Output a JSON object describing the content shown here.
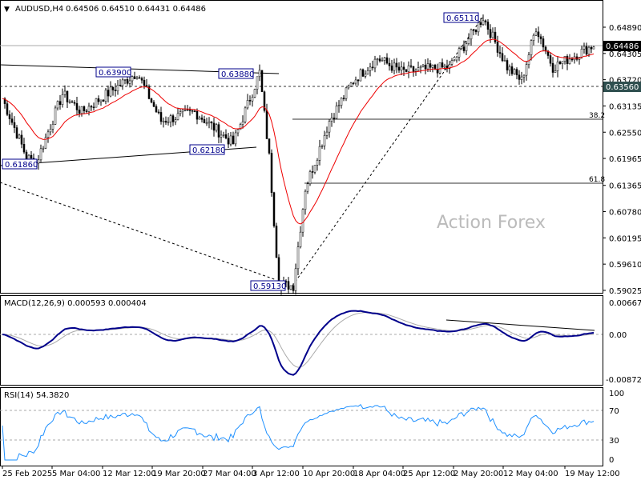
{
  "header": {
    "symbol_label": "AUDUSD,H4",
    "ohlc": "0.64506 0.64510 0.64431 0.64486"
  },
  "watermark": "Action Forex",
  "chart_data": {
    "type": "candlestick",
    "title": "AUDUSD,H4",
    "price_axis": {
      "ticks": [
        "0.64890",
        "0.64305",
        "0.63720",
        "0.63135",
        "0.62550",
        "0.61965",
        "0.61365",
        "0.60780",
        "0.60195",
        "0.59610",
        "0.59025"
      ],
      "range": [
        0.59025,
        0.6525
      ]
    },
    "current_price": "0.64486",
    "support_level": "0.63560",
    "price_keypoints": [
      [
        0,
        0.633
      ],
      [
        10,
        0.62
      ],
      [
        14,
        0.6186
      ],
      [
        25,
        0.634
      ],
      [
        33,
        0.63
      ],
      [
        56,
        0.6388
      ],
      [
        66,
        0.628
      ],
      [
        80,
        0.63
      ],
      [
        96,
        0.623
      ],
      [
        107,
        0.6388
      ],
      [
        111,
        0.62
      ],
      [
        115,
        0.5915
      ],
      [
        121,
        0.5913
      ],
      [
        126,
        0.613
      ],
      [
        136,
        0.628
      ],
      [
        146,
        0.637
      ],
      [
        156,
        0.642
      ],
      [
        166,
        0.639
      ],
      [
        186,
        0.64
      ],
      [
        200,
        0.6511
      ],
      [
        210,
        0.64
      ],
      [
        216,
        0.637
      ],
      [
        222,
        0.6489
      ],
      [
        229,
        0.64
      ],
      [
        246,
        0.6449
      ]
    ],
    "annotations": [
      "0.63900",
      "0.63880",
      "0.62180",
      "0.61860",
      "0.59130",
      "0.65110"
    ],
    "fib_levels": [
      "38.2",
      "61.8"
    ],
    "x_labels": [
      "25 Feb 2025",
      "5 Mar 04:00",
      "12 Mar 12:00",
      "19 Mar 20:00",
      "27 Mar 04:00",
      "3 Apr 12:00",
      "10 Apr 20:00",
      "18 Apr 04:00",
      "25 Apr 12:00",
      "2 May 20:00",
      "12 May 04:00",
      "19 May 12:00"
    ],
    "macd": {
      "label": "MACD(12,26,9) 0.000593 0.000404",
      "ticks": [
        "0.006675",
        "0.00",
        "-0.008724"
      ],
      "range": [
        -0.008724,
        0.006675
      ]
    },
    "rsi": {
      "label": "RSI(14) 54.3820",
      "ticks": [
        "100",
        "70",
        "30",
        "0"
      ],
      "levels": [
        70,
        30
      ]
    }
  }
}
